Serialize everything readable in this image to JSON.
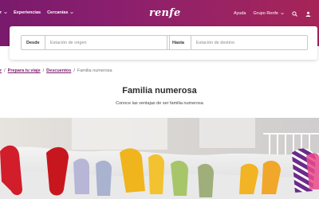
{
  "header": {
    "logo_text": "renfe",
    "nav_left": [
      {
        "label": "r",
        "has_chevron": true
      },
      {
        "label": "Experiencias",
        "has_chevron": false
      },
      {
        "label": "Cercanías",
        "has_chevron": true
      }
    ],
    "nav_right": {
      "help": "Ayuda",
      "group": "Grupo Renfe",
      "icons": [
        "search-icon",
        "user-icon"
      ]
    },
    "colors": {
      "gradient_start": "#7a1a6c",
      "gradient_end": "#a62458"
    }
  },
  "search": {
    "origin_label": "Desde",
    "origin_placeholder": "Estación de origen",
    "destination_label": "Hasta",
    "destination_placeholder": "Estación de destino"
  },
  "breadcrumb": {
    "items": [
      "r",
      "Prepara tu viaje",
      "Descuentos"
    ],
    "current": "Familia numerosa"
  },
  "main": {
    "title": "Familia numerosa",
    "subtitle": "Conoce las ventajas de ser familia numerosa"
  },
  "hero": {
    "image_subject": "feet-in-colorful-socks"
  }
}
